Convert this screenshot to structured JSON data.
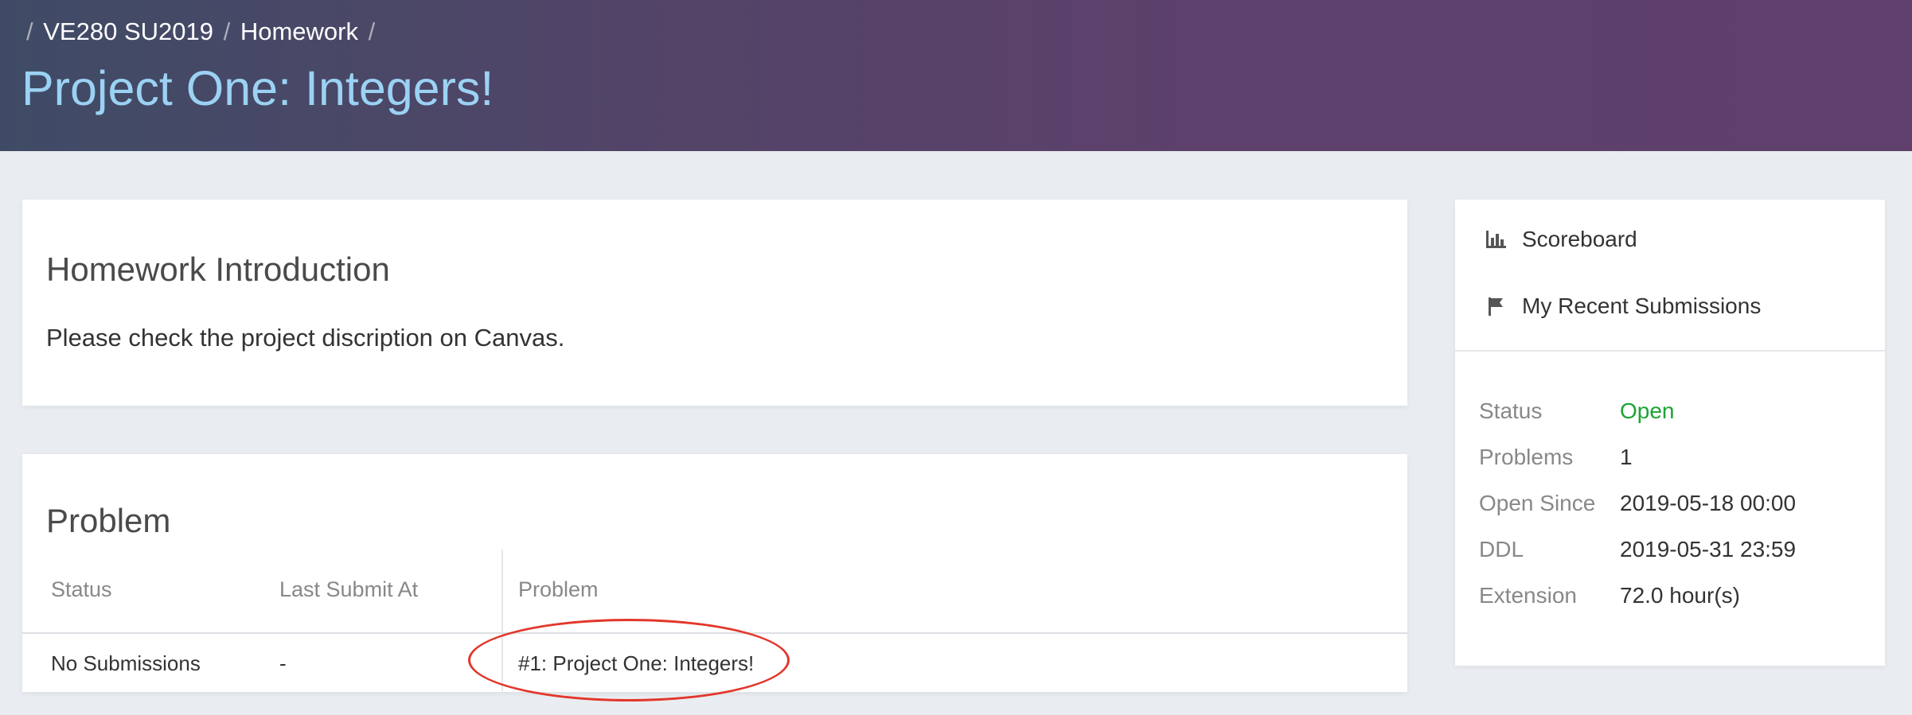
{
  "breadcrumb": [
    {
      "label": "VE280 SU2019"
    },
    {
      "label": "Homework"
    }
  ],
  "breadcrumb_sep": "/",
  "page_title": "Project One: Integers!",
  "intro": {
    "title": "Homework Introduction",
    "body": "Please check the project discription on Canvas."
  },
  "problem_section": {
    "title": "Problem",
    "columns": [
      "Status",
      "Last Submit At",
      "Problem"
    ],
    "rows": [
      {
        "status": "No Submissions",
        "last_submit": "-",
        "problem": "#1: Project One: Integers!"
      }
    ]
  },
  "sidebar": {
    "links": [
      {
        "label": "Scoreboard",
        "icon": "bar-chart-icon"
      },
      {
        "label": "My Recent Submissions",
        "icon": "flag-icon"
      }
    ],
    "info": [
      {
        "label": "Status",
        "value": "Open"
      },
      {
        "label": "Problems",
        "value": "1"
      },
      {
        "label": "Open Since",
        "value": "2019-05-18 00:00"
      },
      {
        "label": "DDL",
        "value": "2019-05-31 23:59"
      },
      {
        "label": "Extension",
        "value": "72.0 hour(s)"
      }
    ]
  },
  "colors": {
    "title": "#9bd2f3",
    "status_open": "#19a533",
    "highlight": "#e2372b",
    "header_left": "#3f4b66",
    "header_right": "#5f3f6c"
  }
}
